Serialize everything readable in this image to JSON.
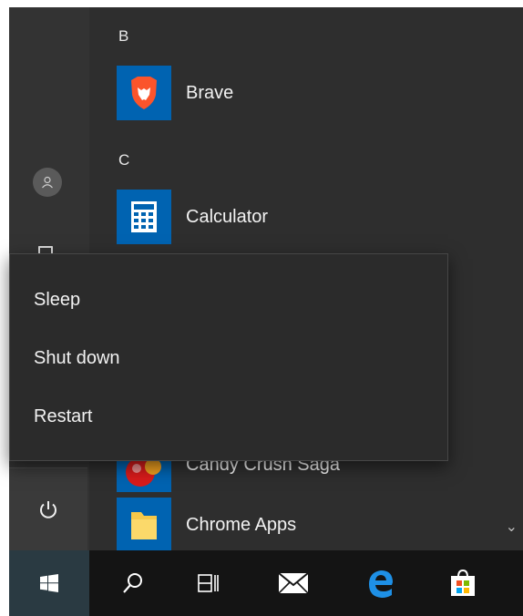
{
  "start_menu": {
    "sections": [
      {
        "letter": "B",
        "apps": [
          {
            "label": "Brave",
            "icon": "brave-icon"
          }
        ]
      },
      {
        "letter": "C",
        "apps": [
          {
            "label": "Calculator",
            "icon": "calculator-icon"
          },
          {
            "label": "Candy Crush Saga",
            "icon": "candy-crush-icon"
          },
          {
            "label": "Chrome Apps",
            "icon": "folder-icon"
          }
        ]
      }
    ],
    "rail": {
      "user_icon": "user-icon",
      "documents_icon": "document-icon",
      "power_icon": "power-icon"
    },
    "scroll_indicator": "chevron-down-icon"
  },
  "power_menu": {
    "items": [
      {
        "label": "Sleep"
      },
      {
        "label": "Shut down"
      },
      {
        "label": "Restart"
      }
    ]
  },
  "taskbar": {
    "items": [
      "windows-start-icon",
      "search-icon",
      "task-view-icon",
      "mail-icon",
      "edge-icon",
      "store-icon"
    ]
  },
  "colors": {
    "menu_bg": "#2e2e2e",
    "flyout_bg": "#2b2b2b",
    "taskbar_bg": "#141414",
    "tile_blue": "#0063b1",
    "brave_orange": "#fb542b",
    "edge_blue": "#1e90e6"
  }
}
